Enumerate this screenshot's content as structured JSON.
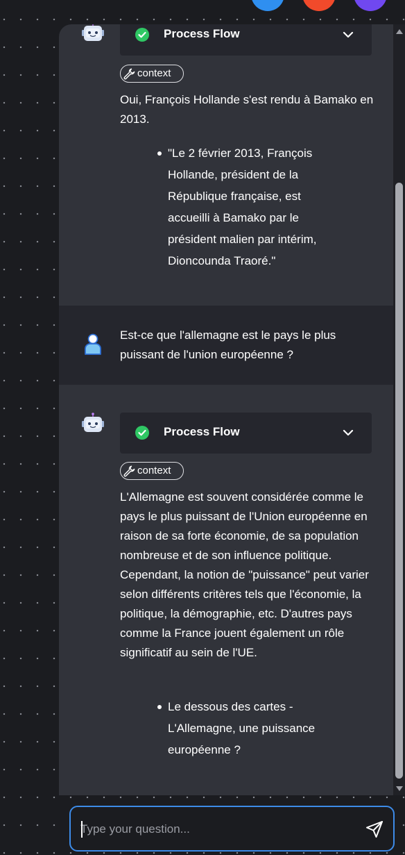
{
  "messages": [
    {
      "role": "bot",
      "process_flow_label": "Process Flow",
      "context_label": "context",
      "text": "Oui, François Hollande s'est rendu à Bamako en 2013.",
      "bullets": [
        "\"Le 2 février 2013, François Hollande, président de la République française, est accueilli à Bamako par le président malien par intérim, Dioncounda Traoré.\""
      ]
    },
    {
      "role": "user",
      "text": "Est-ce que l'allemagne est le pays le plus puissant de l'union européenne ?"
    },
    {
      "role": "bot",
      "process_flow_label": "Process Flow",
      "context_label": "context",
      "text": "L'Allemagne est souvent considérée comme le pays le plus puissant de l'Union européenne en raison de sa forte économie, de sa population nombreuse et de son influence politique. Cependant, la notion de \"puissance\" peut varier selon différents critères tels que l'économie, la politique, la démographie, etc. D'autres pays comme la France jouent également un rôle significatif au sein de l'UE.",
      "bullets": [
        "Le dessous des cartes - L'Allemagne, une puissance européenne ?"
      ]
    }
  ],
  "input": {
    "placeholder": "Type your question...",
    "value": ""
  },
  "icons": {
    "bot_avatar": "robot-icon",
    "user_avatar": "user-icon",
    "status": "check-circle-icon",
    "expand": "chevron-down-icon",
    "tool": "wrench-icon",
    "send": "send-icon"
  },
  "colors": {
    "accent_blue": "#3d8be8",
    "success_green": "#2fc764",
    "panel_bg": "#31333a",
    "user_msg_bg": "#25262d",
    "page_bg": "#1b1c20"
  }
}
